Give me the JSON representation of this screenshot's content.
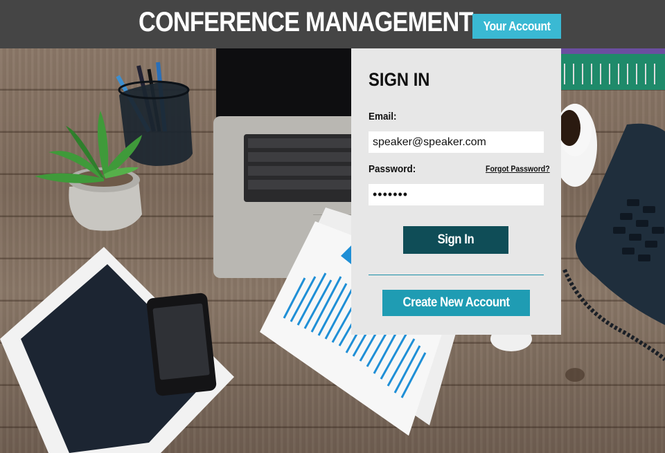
{
  "header": {
    "title": "CONFERENCE MANAGEMENT",
    "account_button": "Your Account"
  },
  "signin": {
    "heading": "SIGN IN",
    "email_label": "Email:",
    "email_value": "speaker@speaker.com",
    "password_label": "Password:",
    "password_value": "•••••••",
    "forgot_link": "Forgot Password?",
    "signin_button": "Sign In",
    "create_account_button": "Create New Account"
  },
  "colors": {
    "header_bg": "#454545",
    "accent": "#3ab9d3",
    "signin_button": "#0f4d57",
    "create_button": "#1f9cb3",
    "panel_bg": "#e7e7e7"
  },
  "background": {
    "icons": [
      "plant-icon",
      "pen-holder-icon",
      "laptop-icon",
      "tablet-icon",
      "phone-icon",
      "coffee-cup-icon",
      "desk-telephone-icon",
      "chart-document-icon",
      "notebook-icon"
    ]
  }
}
